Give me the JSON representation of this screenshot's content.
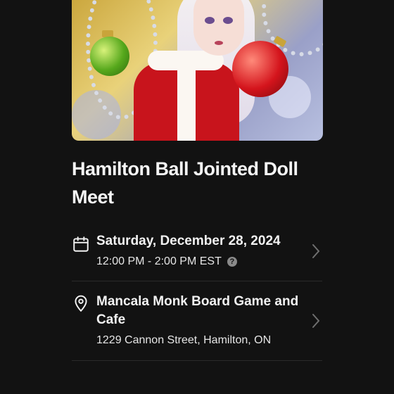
{
  "event": {
    "title": "Hamilton Ball Jointed Doll Meet",
    "image_icon": "event-cover-image"
  },
  "date_row": {
    "icon": "calendar-icon",
    "date": "Saturday, December 28, 2024",
    "time": "12:00 PM - 2:00 PM EST",
    "help_icon": "help-icon",
    "help_glyph": "?",
    "chevron_icon": "chevron-right-icon"
  },
  "location_row": {
    "icon": "map-pin-icon",
    "venue": "Mancala Monk Board Game and Cafe",
    "address": "1229 Cannon Street, Hamilton, ON",
    "chevron_icon": "chevron-right-icon"
  },
  "colors": {
    "background": "#121212",
    "text_primary": "#f2f2f2",
    "divider": "#2a2a2a"
  }
}
